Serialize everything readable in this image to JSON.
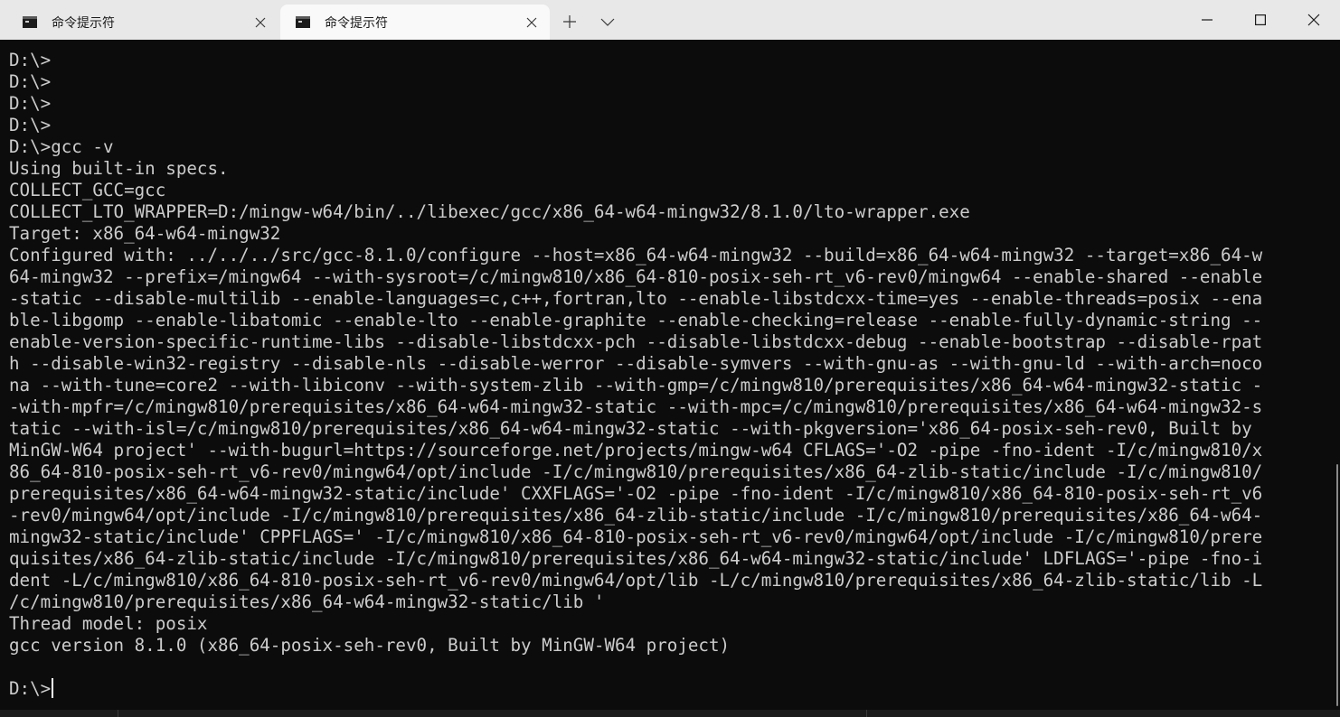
{
  "tabs": [
    {
      "title": "命令提示符",
      "active": false
    },
    {
      "title": "命令提示符",
      "active": true
    }
  ],
  "tab_icons": {
    "terminal": "cmd-prompt-icon",
    "close": "close-icon",
    "new": "plus-icon",
    "dropdown": "chevron-down-icon"
  },
  "window_controls": {
    "minimize": "minimize-icon",
    "maximize": "maximize-icon",
    "close": "close-icon"
  },
  "colors": {
    "background": "#0c0c0c",
    "foreground": "#cccccc",
    "titlebar": "#e8e8e8",
    "active_tab": "#f9f9f9"
  },
  "terminal": {
    "lines": [
      "D:\\>",
      "D:\\>",
      "D:\\>",
      "D:\\>",
      "D:\\>gcc -v",
      "Using built-in specs.",
      "COLLECT_GCC=gcc",
      "COLLECT_LTO_WRAPPER=D:/mingw-w64/bin/../libexec/gcc/x86_64-w64-mingw32/8.1.0/lto-wrapper.exe",
      "Target: x86_64-w64-mingw32",
      "Configured with: ../../../src/gcc-8.1.0/configure --host=x86_64-w64-mingw32 --build=x86_64-w64-mingw32 --target=x86_64-w",
      "64-mingw32 --prefix=/mingw64 --with-sysroot=/c/mingw810/x86_64-810-posix-seh-rt_v6-rev0/mingw64 --enable-shared --enable",
      "-static --disable-multilib --enable-languages=c,c++,fortran,lto --enable-libstdcxx-time=yes --enable-threads=posix --ena",
      "ble-libgomp --enable-libatomic --enable-lto --enable-graphite --enable-checking=release --enable-fully-dynamic-string --",
      "enable-version-specific-runtime-libs --disable-libstdcxx-pch --disable-libstdcxx-debug --enable-bootstrap --disable-rpat",
      "h --disable-win32-registry --disable-nls --disable-werror --disable-symvers --with-gnu-as --with-gnu-ld --with-arch=noco",
      "na --with-tune=core2 --with-libiconv --with-system-zlib --with-gmp=/c/mingw810/prerequisites/x86_64-w64-mingw32-static -",
      "-with-mpfr=/c/mingw810/prerequisites/x86_64-w64-mingw32-static --with-mpc=/c/mingw810/prerequisites/x86_64-w64-mingw32-s",
      "tatic --with-isl=/c/mingw810/prerequisites/x86_64-w64-mingw32-static --with-pkgversion='x86_64-posix-seh-rev0, Built by",
      "MinGW-W64 project' --with-bugurl=https://sourceforge.net/projects/mingw-w64 CFLAGS='-O2 -pipe -fno-ident -I/c/mingw810/x",
      "86_64-810-posix-seh-rt_v6-rev0/mingw64/opt/include -I/c/mingw810/prerequisites/x86_64-zlib-static/include -I/c/mingw810/",
      "prerequisites/x86_64-w64-mingw32-static/include' CXXFLAGS='-O2 -pipe -fno-ident -I/c/mingw810/x86_64-810-posix-seh-rt_v6",
      "-rev0/mingw64/opt/include -I/c/mingw810/prerequisites/x86_64-zlib-static/include -I/c/mingw810/prerequisites/x86_64-w64-",
      "mingw32-static/include' CPPFLAGS=' -I/c/mingw810/x86_64-810-posix-seh-rt_v6-rev0/mingw64/opt/include -I/c/mingw810/prere",
      "quisites/x86_64-zlib-static/include -I/c/mingw810/prerequisites/x86_64-w64-mingw32-static/include' LDFLAGS='-pipe -fno-i",
      "dent -L/c/mingw810/x86_64-810-posix-seh-rt_v6-rev0/mingw64/opt/lib -L/c/mingw810/prerequisites/x86_64-zlib-static/lib -L",
      "/c/mingw810/prerequisites/x86_64-w64-mingw32-static/lib '",
      "Thread model: posix",
      "gcc version 8.1.0 (x86_64-posix-seh-rev0, Built by MinGW-W64 project)",
      ""
    ],
    "prompt": "D:\\>"
  }
}
